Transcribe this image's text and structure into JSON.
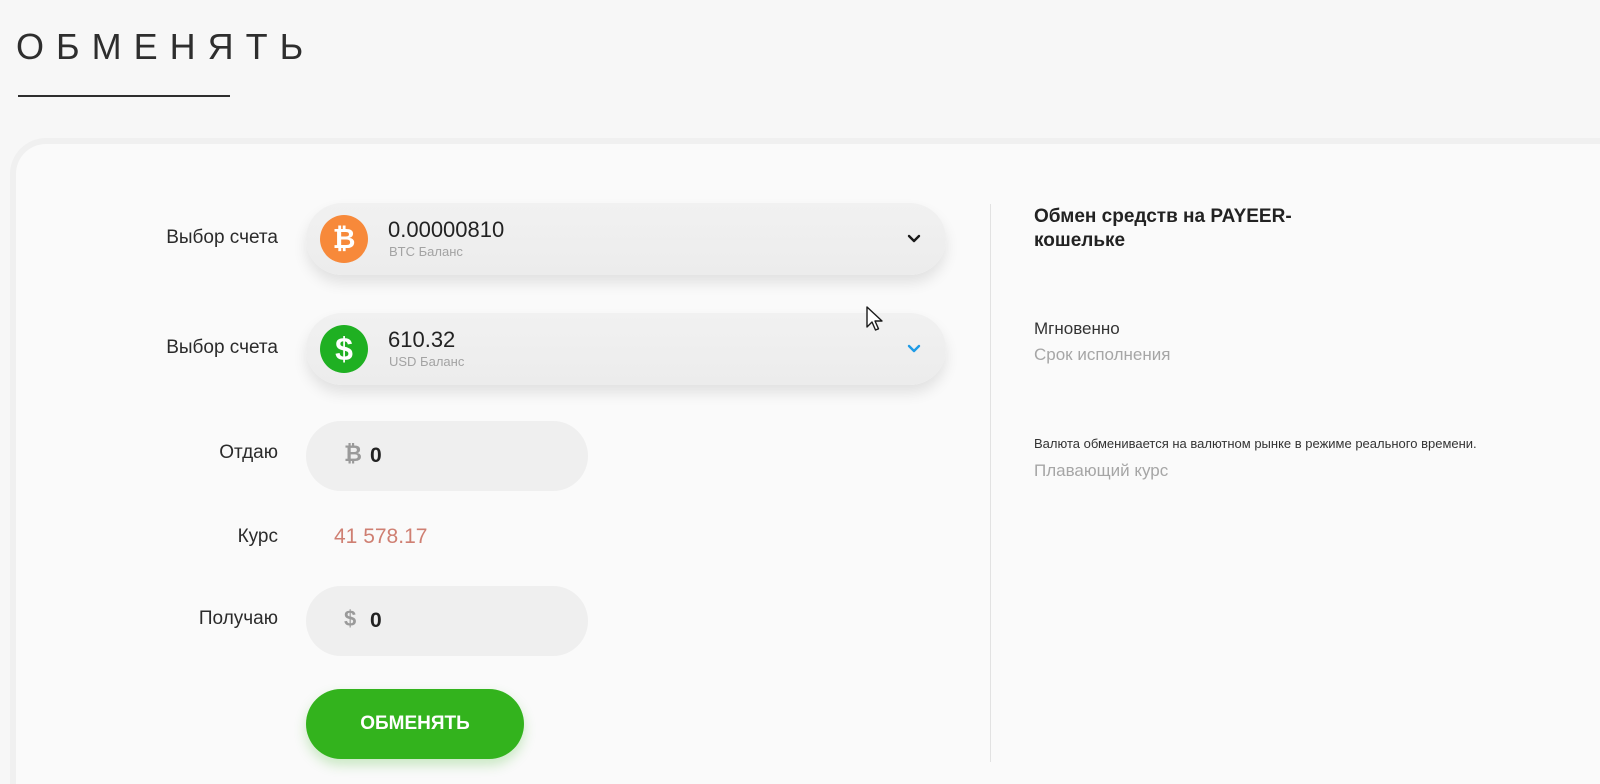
{
  "page": {
    "title": "ОБМЕНЯТЬ"
  },
  "form": {
    "from_account": {
      "label": "Выбор счета",
      "amount": "0.00000810",
      "sub": "BTC Баланс",
      "icon": "bitcoin-icon",
      "icon_glyph": "₿",
      "icon_color": "#f7893a"
    },
    "to_account": {
      "label": "Выбор счета",
      "amount": "610.32",
      "sub": "USD Баланс",
      "icon": "dollar-icon",
      "icon_glyph": "$",
      "icon_color": "#1fb022"
    },
    "give": {
      "label": "Отдаю",
      "symbol": "₿",
      "value": "0"
    },
    "rate": {
      "label": "Курс",
      "value": "41 578.17",
      "color": "#cf7f72"
    },
    "receive": {
      "label": "Получаю",
      "symbol": "$",
      "value": "0"
    },
    "submit_label": "ОБМЕНЯТЬ",
    "submit_color": "#33b31d"
  },
  "info": {
    "title": "Обмен средств на PAYEER-кошельке",
    "timing_value": "Мгновенно",
    "timing_label": "Срок исполнения",
    "rate_desc": "Валюта обменивается на валютном рынке в режиме реального времени.",
    "rate_type": "Плавающий курс"
  }
}
